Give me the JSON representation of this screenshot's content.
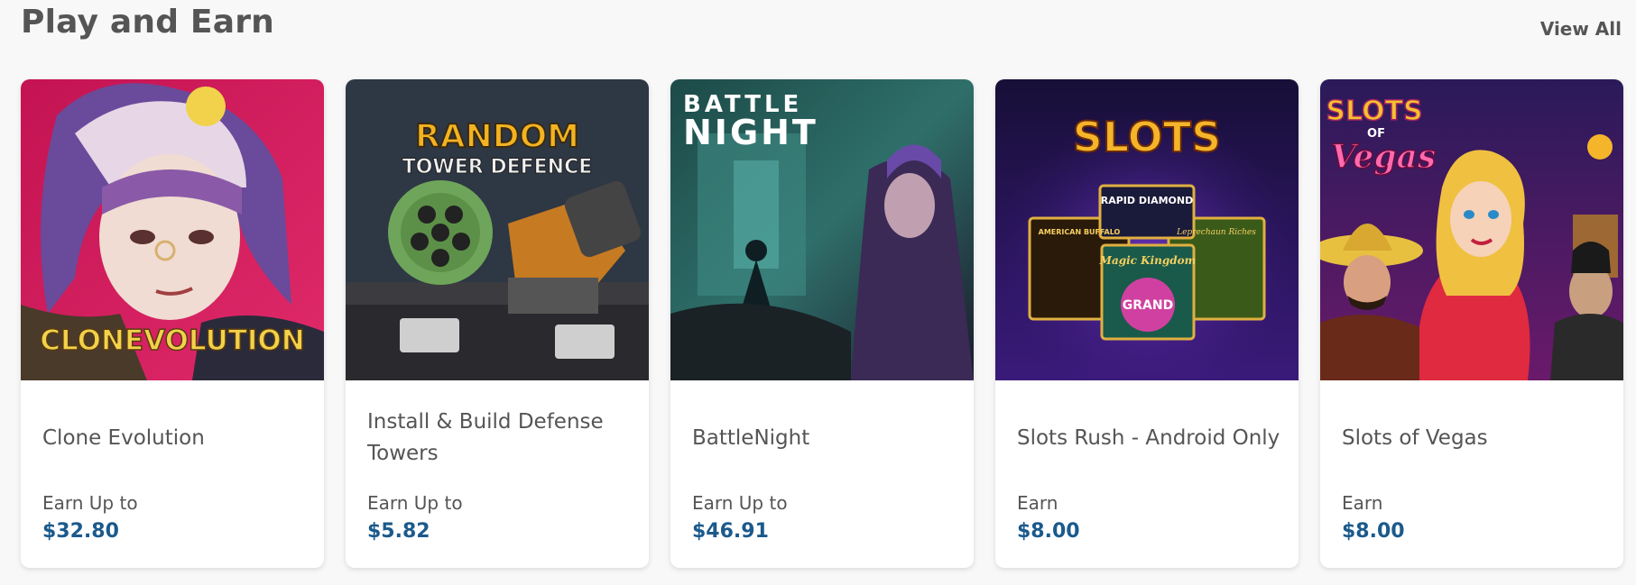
{
  "section": {
    "title": "Play and Earn",
    "view_all_label": "View All"
  },
  "cards": [
    {
      "logo_text": "CLONEVOLUTION",
      "name": "Clone Evolution",
      "earn_label": "Earn Up to",
      "amount": "$32.80"
    },
    {
      "logo_text_line1": "RANDOM",
      "logo_text_line2": "TOWER DEFENCE",
      "name": "Install & Build Defense Towers",
      "earn_label": "Earn Up to",
      "amount": "$5.82"
    },
    {
      "logo_text_line1": "BATTLE",
      "logo_text_line2": "NIGHT",
      "name": "BattleNight",
      "earn_label": "Earn Up to",
      "amount": "$46.91"
    },
    {
      "logo_text": "SLOTS",
      "tile_labels": [
        "RAPID DIAMOND",
        "AMERICAN BUFFALO",
        "Leprechaun Riches",
        "Magic Kingdom",
        "GRAND"
      ],
      "name": "Slots Rush - Android Only",
      "earn_label": "Earn",
      "amount": "$8.00"
    },
    {
      "logo_text_line1": "SLOTS",
      "logo_text_line2": "OF",
      "logo_text_line3": "Vegas",
      "name": "Slots of Vegas",
      "earn_label": "Earn",
      "amount": "$8.00"
    }
  ],
  "colors": {
    "amount": "#1b5a8c",
    "title": "#555555"
  }
}
